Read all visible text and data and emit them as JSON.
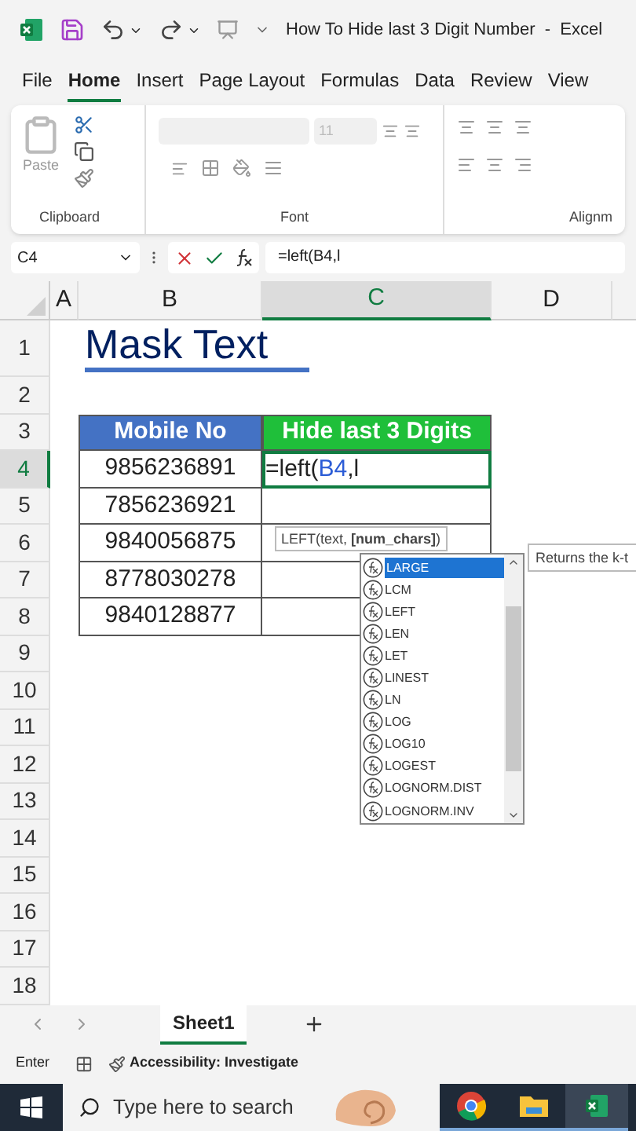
{
  "title_bar": {
    "title": "How To Hide last 3 Digit Number  -  Excel"
  },
  "ribbon_tabs": [
    {
      "label": "File",
      "selected": false
    },
    {
      "label": "Home",
      "selected": true
    },
    {
      "label": "Insert",
      "selected": false
    },
    {
      "label": "Page Layout",
      "selected": false
    },
    {
      "label": "Formulas",
      "selected": false
    },
    {
      "label": "Data",
      "selected": false
    },
    {
      "label": "Review",
      "selected": false
    },
    {
      "label": "View",
      "selected": false
    }
  ],
  "ribbon": {
    "paste_label": "Paste",
    "font_size": "11",
    "groups": [
      "Clipboard",
      "Font",
      "Alignm"
    ]
  },
  "formula_bar": {
    "name_box": "C4",
    "formula": "=left(B4,l"
  },
  "columns": [
    {
      "label": "A",
      "selected": false
    },
    {
      "label": "B",
      "selected": false
    },
    {
      "label": "C",
      "selected": true
    },
    {
      "label": "D",
      "selected": false
    }
  ],
  "rows": [
    {
      "label": "1",
      "selected": false
    },
    {
      "label": "2",
      "selected": false
    },
    {
      "label": "3",
      "selected": false
    },
    {
      "label": "4",
      "selected": true
    },
    {
      "label": "5",
      "selected": false
    },
    {
      "label": "6",
      "selected": false
    },
    {
      "label": "7",
      "selected": false
    },
    {
      "label": "8",
      "selected": false
    },
    {
      "label": "9",
      "selected": false
    },
    {
      "label": "10",
      "selected": false
    },
    {
      "label": "11",
      "selected": false
    },
    {
      "label": "12",
      "selected": false
    },
    {
      "label": "13",
      "selected": false
    },
    {
      "label": "14",
      "selected": false
    },
    {
      "label": "15",
      "selected": false
    },
    {
      "label": "16",
      "selected": false
    },
    {
      "label": "17",
      "selected": false
    },
    {
      "label": "18",
      "selected": false
    }
  ],
  "heading": "Mask Text",
  "table": {
    "columns": [
      {
        "label": "Mobile No",
        "color": "#4472c4"
      },
      {
        "label": "Hide last 3 Digits",
        "color": "#1fbf3a"
      }
    ],
    "rows": [
      "9856236891",
      "7856236921",
      "9840056875",
      "8778030278",
      "9840128877"
    ],
    "editing": {
      "before": "=left(",
      "ref": "B4",
      "after": ",l"
    }
  },
  "tooltip": "LEFT(text, **[num_chars]**)",
  "autocomplete": {
    "items": [
      {
        "label": "LARGE",
        "selected": true
      },
      {
        "label": "LCM",
        "selected": false
      },
      {
        "label": "LEFT",
        "selected": false
      },
      {
        "label": "LEN",
        "selected": false
      },
      {
        "label": "LET",
        "selected": false
      },
      {
        "label": "LINEST",
        "selected": false
      },
      {
        "label": "LN",
        "selected": false
      },
      {
        "label": "LOG",
        "selected": false
      },
      {
        "label": "LOG10",
        "selected": false
      },
      {
        "label": "LOGEST",
        "selected": false
      },
      {
        "label": "LOGNORM.DIST",
        "selected": false
      },
      {
        "label": "LOGNORM.INV",
        "selected": false
      }
    ],
    "description": "Returns the k-t"
  },
  "sheet_tabs": [
    {
      "label": "Sheet1",
      "selected": true
    }
  ],
  "status_bar": {
    "mode": "Enter",
    "accessibility": "Accessibility: Investigate"
  },
  "taskbar": {
    "search_placeholder": "Type here to search",
    "apps": [
      {
        "kind": "chrome",
        "selected": false
      },
      {
        "kind": "folder",
        "selected": false
      },
      {
        "kind": "excel",
        "selected": true
      }
    ]
  }
}
